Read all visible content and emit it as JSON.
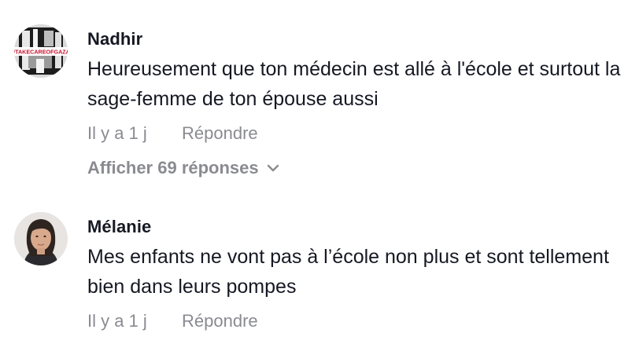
{
  "comments": [
    {
      "username": "Nadhir",
      "avatar_icon": "takecareofgaza-avatar-icon",
      "avatar_text": "#TAKECAREOFGAZA",
      "text": "Heureusement que ton médecin est allé à l'école et surtout la sage-femme de ton épouse aussi",
      "time": "Il y a 1 j",
      "reply_label": "Répondre",
      "view_replies_label": "Afficher 69 réponses"
    },
    {
      "username": "Mélanie",
      "avatar_icon": "user-photo-avatar-icon",
      "text": "Mes enfants ne vont pas à l’école non plus et sont tellement bien dans leurs pompes",
      "time": "Il y a 1 j",
      "reply_label": "Répondre"
    }
  ]
}
